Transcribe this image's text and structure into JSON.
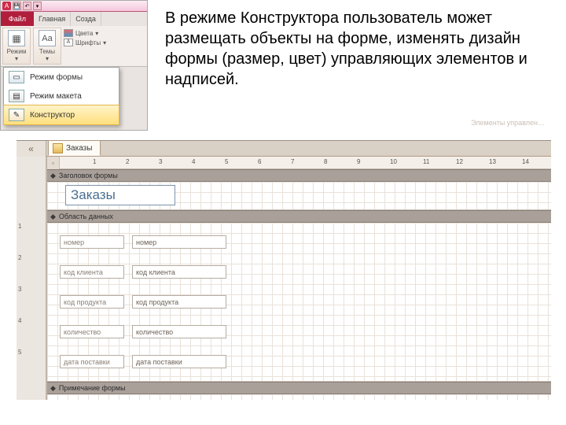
{
  "ribbon": {
    "app_letter": "A",
    "file_tab": "Файл",
    "tabs": [
      "Главная",
      "Созда"
    ],
    "big_buttons": {
      "view": "Режим",
      "themes": "Темы"
    },
    "mini": {
      "colors": "Цвета",
      "fonts": "Шрифты"
    }
  },
  "view_menu": {
    "items": [
      {
        "label": "Режим формы"
      },
      {
        "label": "Режим макета"
      },
      {
        "label": "Конструктор",
        "selected": true
      }
    ]
  },
  "explain_text": "В режиме Конструктора  пользователь может размещать объекты на форме, изменять дизайн формы (размер, цвет) управляющих элементов и надписей.",
  "designer": {
    "nav_glyph": "«",
    "tab_label": "Заказы",
    "page_ghost": "Элементы управлен…",
    "ruler_marks": [
      "1",
      "2",
      "3",
      "4",
      "5",
      "6",
      "7",
      "8",
      "9",
      "10",
      "11",
      "12",
      "13",
      "14"
    ],
    "sections": {
      "header": "Заголовок формы",
      "detail": "Область данных",
      "footer": "Примечание формы"
    },
    "form_title": "Заказы",
    "fields": [
      {
        "label": "номер",
        "bound": "номер"
      },
      {
        "label": "код клиента",
        "bound": "код клиента"
      },
      {
        "label": "код продукта",
        "bound": "код продукта"
      },
      {
        "label": "количество",
        "bound": "количество"
      },
      {
        "label": "дата поставки",
        "bound": "дата поставки"
      }
    ],
    "vruler": [
      "1",
      "2",
      "3",
      "4",
      "5"
    ]
  }
}
